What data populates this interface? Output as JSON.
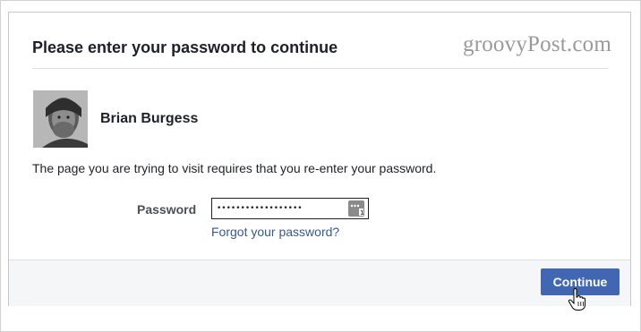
{
  "watermark": "groovyPost.com",
  "dialog": {
    "title": "Please enter your password to continue",
    "user": {
      "name": "Brian Burgess",
      "avatar_icon": "user-photo"
    },
    "message": "The page you are trying to visit requires that you re-enter your password.",
    "password": {
      "label": "Password",
      "value": "••••••••••••••••••",
      "manager_icon": "password-manager-key-icon"
    },
    "forgot_link": "Forgot your password?",
    "continue_label": "Continue"
  },
  "colors": {
    "primary_button": "#4267b2",
    "link": "#365899",
    "footer_bg": "#f5f6f7",
    "text": "#1d2129"
  }
}
